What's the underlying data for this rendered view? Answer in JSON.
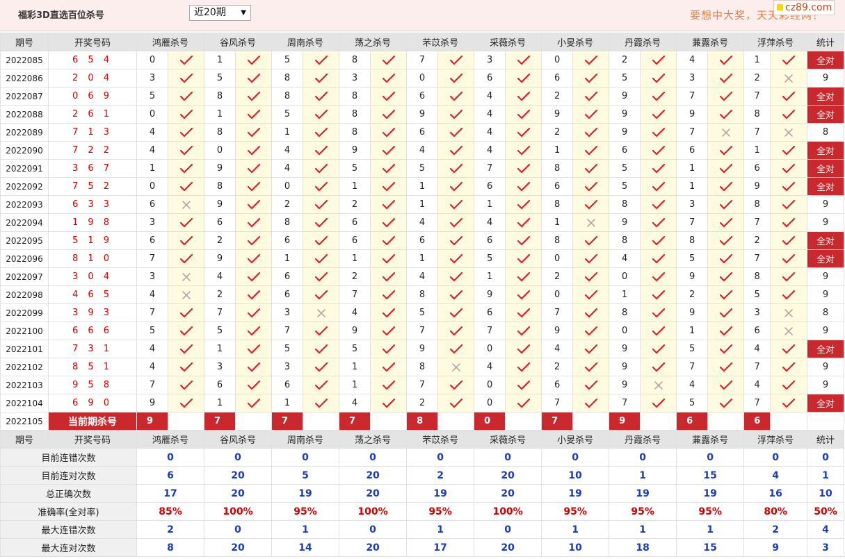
{
  "header": {
    "title": "福彩3D直选百位杀号",
    "period_select": "近20期",
    "slogan": "要想中大奖，天天彩经网！",
    "logo": "cz89.com"
  },
  "columns": {
    "issue": "期号",
    "draw": "开奖号码",
    "experts": [
      "鸿雁杀号",
      "谷风杀号",
      "周南杀号",
      "荡之杀号",
      "芣苡杀号",
      "采薇杀号",
      "小旻杀号",
      "丹霞杀号",
      "蒹露杀号",
      "浮萍杀号"
    ],
    "stat": "统计"
  },
  "rows": [
    {
      "issue": "2022085",
      "draw": "6 5 4",
      "kills": [
        [
          "0",
          1
        ],
        [
          "1",
          1
        ],
        [
          "5",
          1
        ],
        [
          "8",
          1
        ],
        [
          "7",
          1
        ],
        [
          "3",
          1
        ],
        [
          "0",
          1
        ],
        [
          "2",
          1
        ],
        [
          "4",
          1
        ],
        [
          "1",
          1
        ]
      ],
      "stat": "全对"
    },
    {
      "issue": "2022086",
      "draw": "2 0 4",
      "kills": [
        [
          "3",
          1
        ],
        [
          "5",
          1
        ],
        [
          "8",
          1
        ],
        [
          "3",
          1
        ],
        [
          "0",
          1
        ],
        [
          "6",
          1
        ],
        [
          "6",
          1
        ],
        [
          "5",
          1
        ],
        [
          "3",
          1
        ],
        [
          "2",
          0
        ]
      ],
      "stat": "9"
    },
    {
      "issue": "2022087",
      "draw": "0 6 9",
      "kills": [
        [
          "5",
          1
        ],
        [
          "8",
          1
        ],
        [
          "8",
          1
        ],
        [
          "8",
          1
        ],
        [
          "6",
          1
        ],
        [
          "4",
          1
        ],
        [
          "2",
          1
        ],
        [
          "9",
          1
        ],
        [
          "7",
          1
        ],
        [
          "7",
          1
        ]
      ],
      "stat": "全对"
    },
    {
      "issue": "2022088",
      "draw": "2 6 1",
      "kills": [
        [
          "0",
          1
        ],
        [
          "1",
          1
        ],
        [
          "5",
          1
        ],
        [
          "8",
          1
        ],
        [
          "9",
          1
        ],
        [
          "4",
          1
        ],
        [
          "9",
          1
        ],
        [
          "9",
          1
        ],
        [
          "9",
          1
        ],
        [
          "8",
          1
        ]
      ],
      "stat": "全对"
    },
    {
      "issue": "2022089",
      "draw": "7 1 3",
      "kills": [
        [
          "4",
          1
        ],
        [
          "8",
          1
        ],
        [
          "1",
          1
        ],
        [
          "8",
          1
        ],
        [
          "6",
          1
        ],
        [
          "4",
          1
        ],
        [
          "2",
          1
        ],
        [
          "9",
          1
        ],
        [
          "7",
          0
        ],
        [
          "7",
          0
        ]
      ],
      "stat": "8"
    },
    {
      "issue": "2022090",
      "draw": "7 2 2",
      "kills": [
        [
          "4",
          1
        ],
        [
          "0",
          1
        ],
        [
          "4",
          1
        ],
        [
          "9",
          1
        ],
        [
          "4",
          1
        ],
        [
          "4",
          1
        ],
        [
          "1",
          1
        ],
        [
          "6",
          1
        ],
        [
          "6",
          1
        ],
        [
          "1",
          1
        ]
      ],
      "stat": "全对"
    },
    {
      "issue": "2022091",
      "draw": "3 6 7",
      "kills": [
        [
          "1",
          1
        ],
        [
          "9",
          1
        ],
        [
          "4",
          1
        ],
        [
          "5",
          1
        ],
        [
          "5",
          1
        ],
        [
          "7",
          1
        ],
        [
          "8",
          1
        ],
        [
          "5",
          1
        ],
        [
          "1",
          1
        ],
        [
          "6",
          1
        ]
      ],
      "stat": "全对"
    },
    {
      "issue": "2022092",
      "draw": "7 5 2",
      "kills": [
        [
          "0",
          1
        ],
        [
          "8",
          1
        ],
        [
          "0",
          1
        ],
        [
          "1",
          1
        ],
        [
          "1",
          1
        ],
        [
          "6",
          1
        ],
        [
          "6",
          1
        ],
        [
          "5",
          1
        ],
        [
          "1",
          1
        ],
        [
          "9",
          1
        ]
      ],
      "stat": "全对"
    },
    {
      "issue": "2022093",
      "draw": "6 3 3",
      "kills": [
        [
          "6",
          0
        ],
        [
          "9",
          1
        ],
        [
          "2",
          1
        ],
        [
          "2",
          1
        ],
        [
          "1",
          1
        ],
        [
          "1",
          1
        ],
        [
          "8",
          1
        ],
        [
          "8",
          1
        ],
        [
          "3",
          1
        ],
        [
          "8",
          1
        ]
      ],
      "stat": "9"
    },
    {
      "issue": "2022094",
      "draw": "1 9 8",
      "kills": [
        [
          "3",
          1
        ],
        [
          "6",
          1
        ],
        [
          "8",
          1
        ],
        [
          "6",
          1
        ],
        [
          "4",
          1
        ],
        [
          "4",
          1
        ],
        [
          "1",
          0
        ],
        [
          "9",
          1
        ],
        [
          "7",
          1
        ],
        [
          "7",
          1
        ]
      ],
      "stat": "9"
    },
    {
      "issue": "2022095",
      "draw": "5 1 9",
      "kills": [
        [
          "6",
          1
        ],
        [
          "2",
          1
        ],
        [
          "6",
          1
        ],
        [
          "6",
          1
        ],
        [
          "6",
          1
        ],
        [
          "6",
          1
        ],
        [
          "8",
          1
        ],
        [
          "8",
          1
        ],
        [
          "8",
          1
        ],
        [
          "2",
          1
        ]
      ],
      "stat": "全对"
    },
    {
      "issue": "2022096",
      "draw": "8 1 0",
      "kills": [
        [
          "7",
          1
        ],
        [
          "9",
          1
        ],
        [
          "1",
          1
        ],
        [
          "1",
          1
        ],
        [
          "1",
          1
        ],
        [
          "5",
          1
        ],
        [
          "0",
          1
        ],
        [
          "4",
          1
        ],
        [
          "5",
          1
        ],
        [
          "7",
          1
        ]
      ],
      "stat": "全对"
    },
    {
      "issue": "2022097",
      "draw": "3 0 4",
      "kills": [
        [
          "3",
          0
        ],
        [
          "4",
          1
        ],
        [
          "6",
          1
        ],
        [
          "2",
          1
        ],
        [
          "4",
          1
        ],
        [
          "1",
          1
        ],
        [
          "2",
          1
        ],
        [
          "0",
          1
        ],
        [
          "9",
          1
        ],
        [
          "8",
          1
        ]
      ],
      "stat": "9"
    },
    {
      "issue": "2022098",
      "draw": "4 6 5",
      "kills": [
        [
          "4",
          0
        ],
        [
          "2",
          1
        ],
        [
          "6",
          1
        ],
        [
          "7",
          1
        ],
        [
          "8",
          1
        ],
        [
          "9",
          1
        ],
        [
          "0",
          1
        ],
        [
          "1",
          1
        ],
        [
          "2",
          1
        ],
        [
          "5",
          1
        ]
      ],
      "stat": "9"
    },
    {
      "issue": "2022099",
      "draw": "3 9 3",
      "kills": [
        [
          "7",
          1
        ],
        [
          "7",
          1
        ],
        [
          "3",
          0
        ],
        [
          "4",
          1
        ],
        [
          "5",
          1
        ],
        [
          "6",
          1
        ],
        [
          "7",
          1
        ],
        [
          "8",
          1
        ],
        [
          "9",
          1
        ],
        [
          "3",
          0
        ]
      ],
      "stat": "8"
    },
    {
      "issue": "2022100",
      "draw": "6 6 6",
      "kills": [
        [
          "5",
          1
        ],
        [
          "5",
          1
        ],
        [
          "7",
          1
        ],
        [
          "9",
          1
        ],
        [
          "7",
          1
        ],
        [
          "7",
          1
        ],
        [
          "9",
          1
        ],
        [
          "0",
          1
        ],
        [
          "1",
          1
        ],
        [
          "6",
          0
        ]
      ],
      "stat": "9"
    },
    {
      "issue": "2022101",
      "draw": "7 3 1",
      "kills": [
        [
          "4",
          1
        ],
        [
          "1",
          1
        ],
        [
          "5",
          1
        ],
        [
          "5",
          1
        ],
        [
          "9",
          1
        ],
        [
          "0",
          1
        ],
        [
          "4",
          1
        ],
        [
          "9",
          1
        ],
        [
          "5",
          1
        ],
        [
          "4",
          1
        ]
      ],
      "stat": "全对"
    },
    {
      "issue": "2022102",
      "draw": "8 5 1",
      "kills": [
        [
          "4",
          1
        ],
        [
          "3",
          1
        ],
        [
          "3",
          1
        ],
        [
          "1",
          1
        ],
        [
          "8",
          0
        ],
        [
          "4",
          1
        ],
        [
          "2",
          1
        ],
        [
          "9",
          1
        ],
        [
          "7",
          1
        ],
        [
          "7",
          1
        ]
      ],
      "stat": "9"
    },
    {
      "issue": "2022103",
      "draw": "9 5 8",
      "kills": [
        [
          "7",
          1
        ],
        [
          "6",
          1
        ],
        [
          "6",
          1
        ],
        [
          "1",
          1
        ],
        [
          "7",
          1
        ],
        [
          "0",
          1
        ],
        [
          "6",
          1
        ],
        [
          "9",
          0
        ],
        [
          "4",
          1
        ],
        [
          "4",
          1
        ]
      ],
      "stat": "9"
    },
    {
      "issue": "2022104",
      "draw": "6 9 0",
      "kills": [
        [
          "9",
          1
        ],
        [
          "1",
          1
        ],
        [
          "1",
          1
        ],
        [
          "4",
          1
        ],
        [
          "2",
          1
        ],
        [
          "0",
          1
        ],
        [
          "7",
          1
        ],
        [
          "7",
          1
        ],
        [
          "5",
          1
        ],
        [
          "7",
          1
        ]
      ],
      "stat": "全对"
    }
  ],
  "current": {
    "issue": "2022105",
    "label": "当前期杀号",
    "picks": [
      "9",
      "7",
      "7",
      "7",
      "8",
      "0",
      "7",
      "9",
      "6",
      "6"
    ]
  },
  "stats": [
    {
      "label": "目前连错次数",
      "values": [
        "0",
        "0",
        "0",
        "0",
        "0",
        "0",
        "0",
        "0",
        "0",
        "0",
        "0"
      ],
      "red": false
    },
    {
      "label": "目前连对次数",
      "values": [
        "6",
        "20",
        "5",
        "20",
        "2",
        "20",
        "10",
        "1",
        "15",
        "4",
        "1"
      ],
      "red": false
    },
    {
      "label": "总正确次数",
      "values": [
        "17",
        "20",
        "19",
        "20",
        "19",
        "20",
        "19",
        "19",
        "19",
        "16",
        "10"
      ],
      "red": false
    },
    {
      "label": "准确率(全对率)",
      "values": [
        "85%",
        "100%",
        "95%",
        "100%",
        "95%",
        "100%",
        "95%",
        "95%",
        "95%",
        "80%",
        "50%"
      ],
      "red": true
    },
    {
      "label": "最大连错次数",
      "values": [
        "2",
        "0",
        "1",
        "0",
        "1",
        "0",
        "1",
        "1",
        "1",
        "2",
        "4"
      ],
      "red": false
    },
    {
      "label": "最大连对次数",
      "values": [
        "8",
        "20",
        "14",
        "20",
        "17",
        "20",
        "10",
        "18",
        "15",
        "9",
        "3"
      ],
      "red": false
    }
  ],
  "colors": {
    "accent": "#c9282d",
    "check": "#e0202a",
    "cross": "#aaaaaa"
  }
}
